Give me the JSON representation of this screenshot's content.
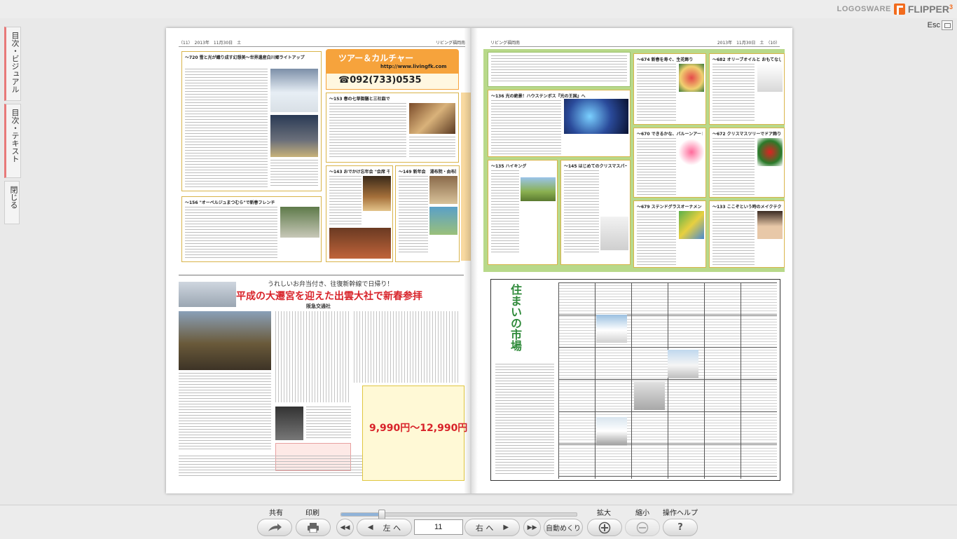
{
  "app": {
    "logo_brand": "LOGOSWARE",
    "logo_product": "FLIPPER",
    "logo_version": "3",
    "esc_label": "Esc"
  },
  "side_tabs": [
    {
      "label": "目次・ビジュアル"
    },
    {
      "label": "目次・テキスト"
    },
    {
      "label": "閉じる"
    }
  ],
  "book": {
    "left_page": {
      "header_left": "（11）　2013年　11月30日　土",
      "header_right": "リビング福岡南",
      "tour_title": "ツアー＆カルチャー",
      "phone": "☎092(733)0535",
      "web": "http://www.livingfk.com",
      "card_titles": [
        "～720 雪と光が織り成す幻想美～世界遺産白川郷ライトアップ",
        "～153 春の七草御膳と三社詣で",
        "～143 おでかけ忘年会 \"会席 千匹丸\"",
        "～149 新年会　湯布院・由布院で過ごす極上の時間",
        "～156 \"オーベルジュまつむら\"で新春フレンチ"
      ],
      "ad_sub": "うれしいお弁当付き、往復新幹線で日帰り！",
      "ad_headline": "平成の大遷宮を迎えた出雲大社で新春参拝",
      "ad_company": "阪急交通社",
      "ad_price": "9,990円～12,990円"
    },
    "right_page": {
      "header_left": "リビング福岡南",
      "header_right": "2013年　11月30日　土　（10）",
      "card_titles": [
        "～136 光の絶景！ハウステンボス『光の王国』へ",
        "～674 新春を寿ぐ、生花飾り",
        "～682 オリーブオイルと おもてなしメニュー",
        "～670 できるかな、バルーンアート",
        "～672 クリスマスツリーでドア飾り",
        "～135 ハイキング",
        "～145 はじめてのクリスマスパーティ",
        "～679 ステンドグラスオーナメント",
        "～133 ここぞという時のメイクテク"
      ],
      "market_title": "住まいの市場"
    }
  },
  "toolbar": {
    "share_label": "共有",
    "print_label": "印刷",
    "prev_label": "左 へ",
    "next_label": "右 へ",
    "page_value": "11",
    "auto_label": "自動めくり",
    "zoom_in_label": "拡大",
    "zoom_out_label": "縮小",
    "help_label": "操作ヘルプ",
    "help_glyph": "?",
    "slider_position": 0.17
  }
}
